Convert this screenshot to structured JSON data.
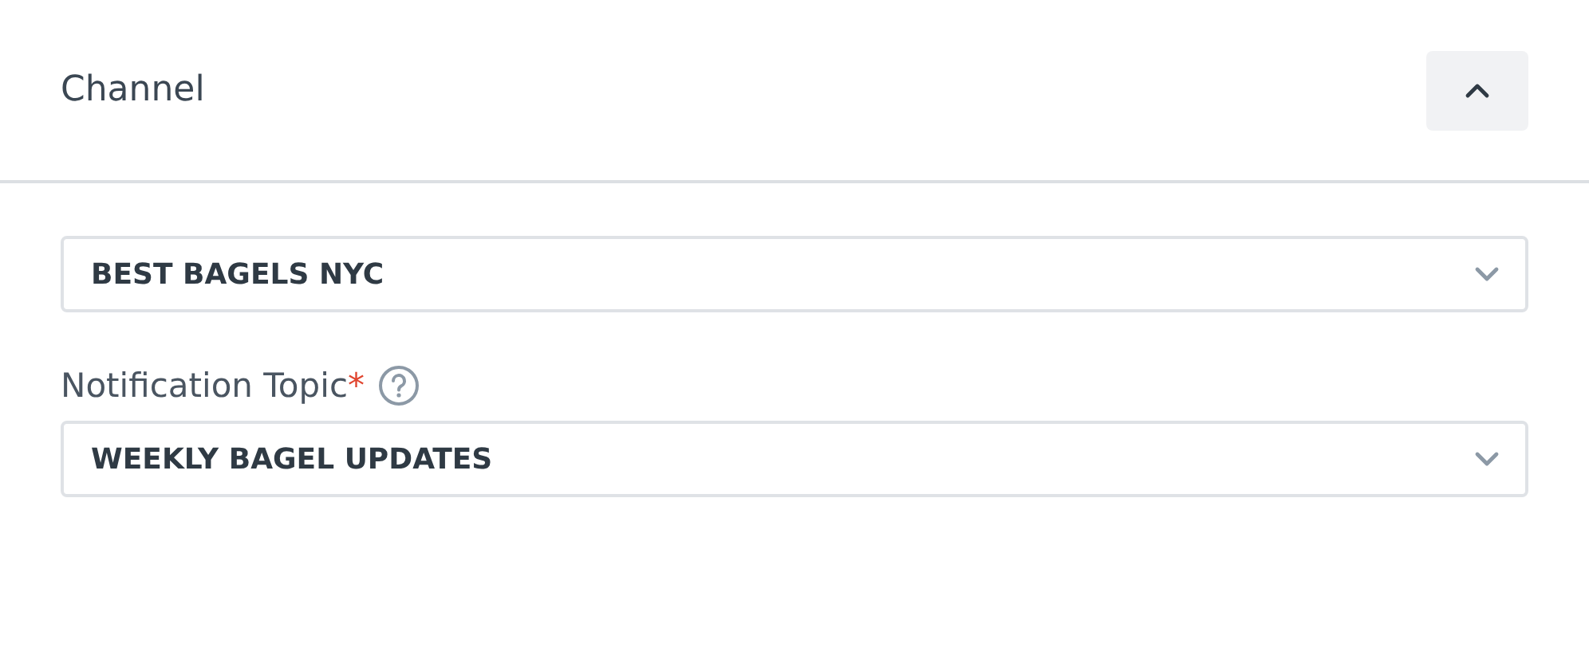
{
  "section": {
    "title": "Channel",
    "expanded": true
  },
  "fields": [
    {
      "value": "BEST BAGELS NYC"
    },
    {
      "label": "Notification Topic",
      "required": true,
      "required_mark": "*",
      "help": true,
      "value": "WEEKLY BAGEL UPDATES"
    }
  ]
}
